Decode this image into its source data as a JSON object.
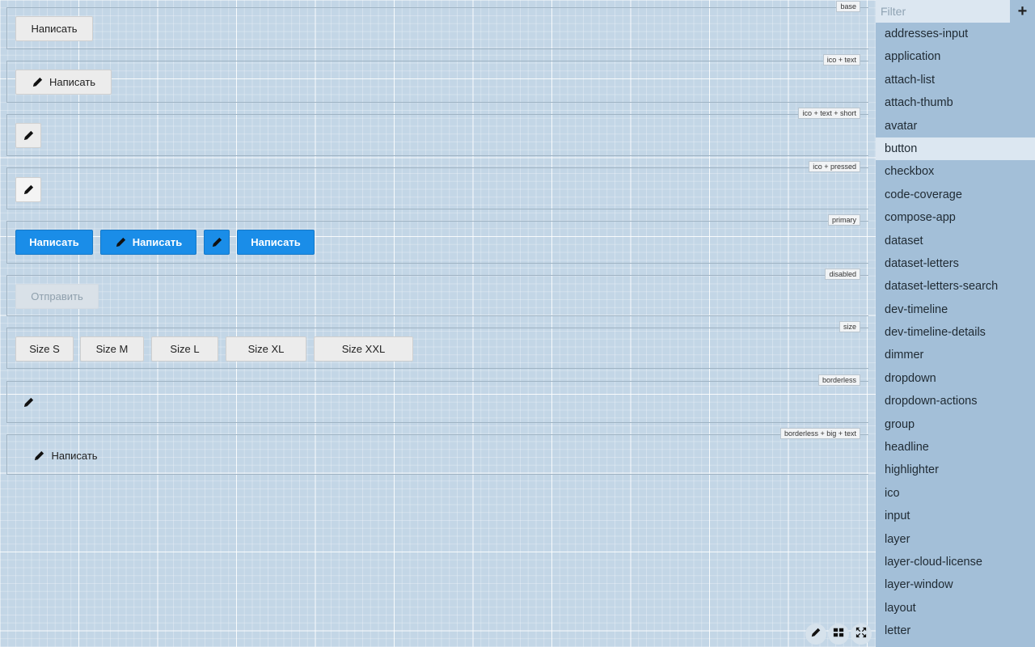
{
  "sections": [
    {
      "label": "base",
      "buttons": [
        {
          "text": "Написать"
        }
      ]
    },
    {
      "label": "ico + text",
      "buttons": [
        {
          "text": "Написать",
          "icon": "pencil-icon"
        }
      ]
    },
    {
      "label": "ico + text + short",
      "buttons": [
        {
          "text": "",
          "icon": "pencil-icon"
        }
      ]
    },
    {
      "label": "ico + pressed",
      "buttons": [
        {
          "text": "",
          "icon": "pencil-icon"
        }
      ]
    },
    {
      "label": "primary",
      "buttons": [
        {
          "text": "Написать"
        },
        {
          "text": "Написать",
          "icon": "pencil-icon"
        },
        {
          "text": "",
          "icon": "pencil-icon"
        },
        {
          "text": "Написать"
        }
      ]
    },
    {
      "label": "disabled",
      "buttons": [
        {
          "text": "Отправить"
        }
      ]
    },
    {
      "label": "size",
      "buttons": [
        {
          "text": "Size S"
        },
        {
          "text": "Size M"
        },
        {
          "text": "Size L"
        },
        {
          "text": "Size XL"
        },
        {
          "text": "Size XXL"
        }
      ]
    },
    {
      "label": "borderless",
      "buttons": [
        {
          "text": "",
          "icon": "pencil-icon"
        }
      ]
    },
    {
      "label": "borderless + big + text",
      "buttons": [
        {
          "text": "Написать",
          "icon": "pencil-icon"
        }
      ]
    }
  ],
  "sidebar": {
    "filter_placeholder": "Filter",
    "add_label": "+",
    "active_item": "button",
    "items": [
      "addresses-input",
      "application",
      "attach-list",
      "attach-thumb",
      "avatar",
      "button",
      "checkbox",
      "code-coverage",
      "compose-app",
      "dataset",
      "dataset-letters",
      "dataset-letters-search",
      "dev-timeline",
      "dev-timeline-details",
      "dimmer",
      "dropdown",
      "dropdown-actions",
      "group",
      "headline",
      "highlighter",
      "ico",
      "input",
      "layer",
      "layer-cloud-license",
      "layer-window",
      "layout",
      "letter"
    ]
  },
  "tools": [
    {
      "icon": "pencil-icon"
    },
    {
      "icon": "grid-icon"
    },
    {
      "icon": "expand-icon"
    }
  ],
  "colors": {
    "primary": "#1a8de8",
    "background": "#c3d6e6",
    "sidebar": "#a3bfd8",
    "sidebar_active": "#dce7f1"
  }
}
